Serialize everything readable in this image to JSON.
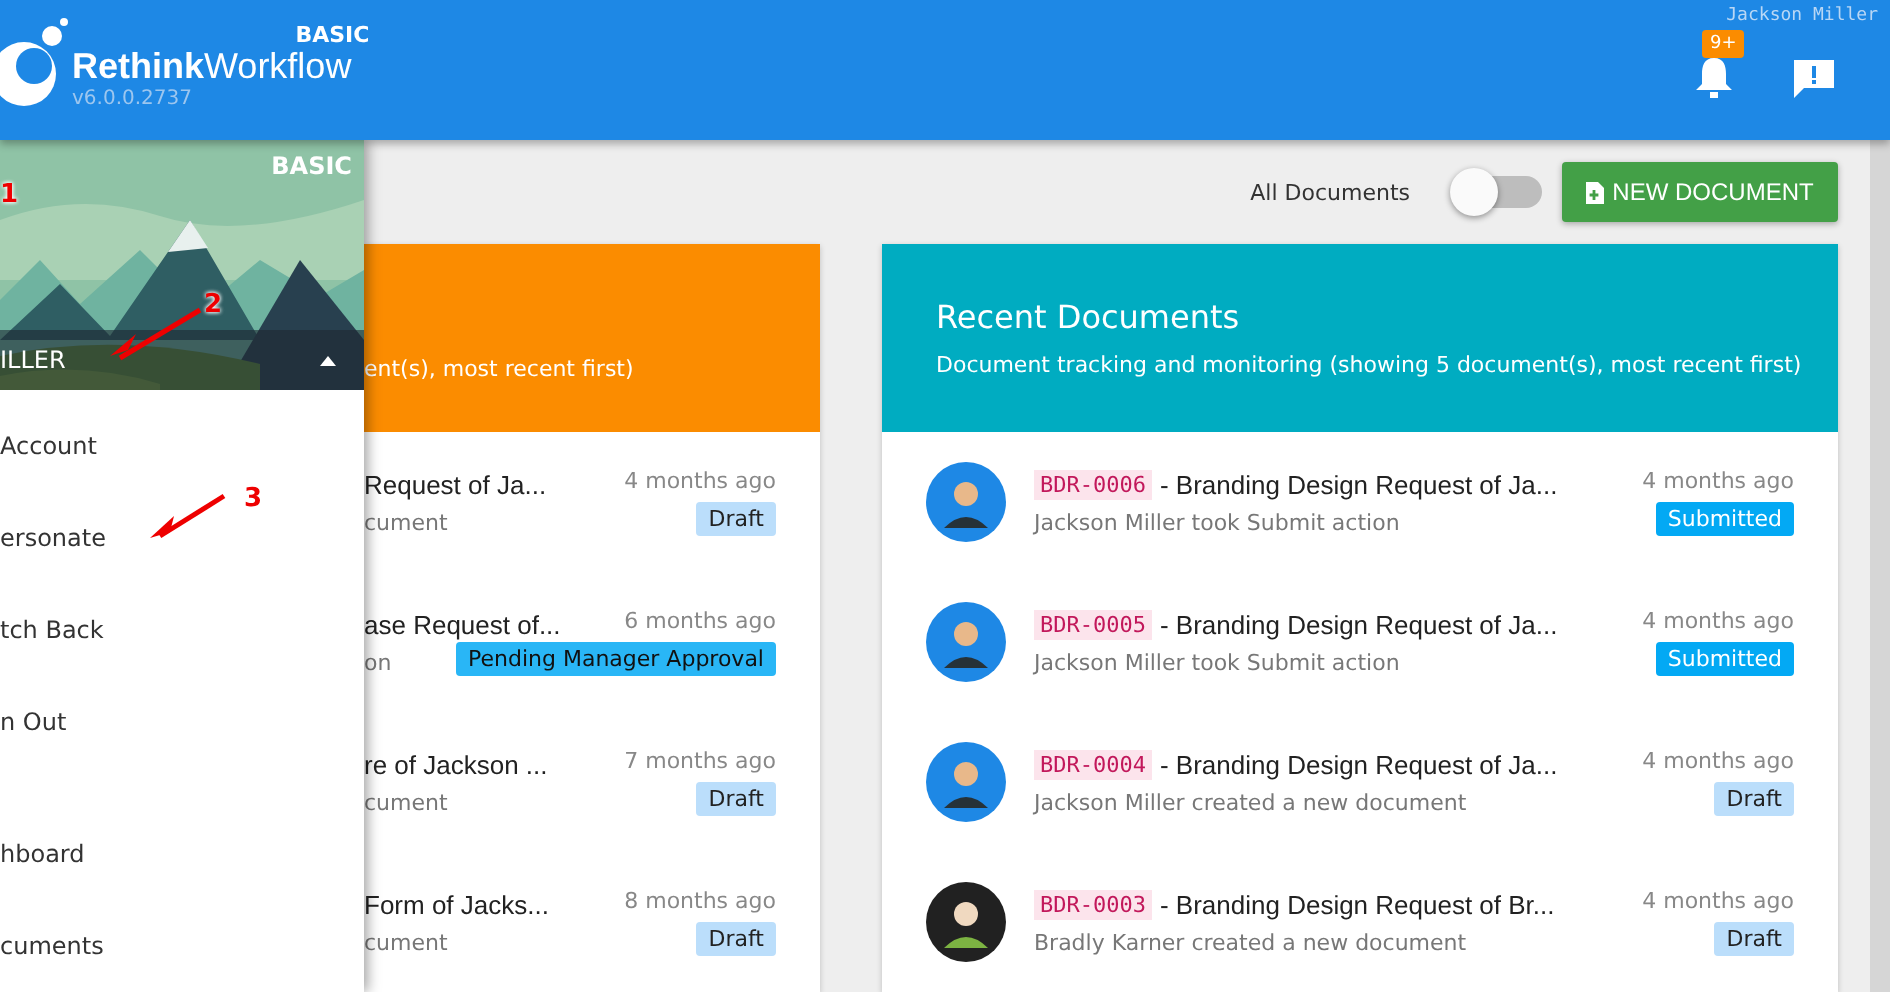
{
  "header": {
    "brand": "**Rethink**Workflow",
    "version": "v6.0.0.2737",
    "edition": "BASIC",
    "user": "Jackson Miller",
    "notifications": "9+"
  },
  "drawer": {
    "edition": "BASIC",
    "user": "ILLER",
    "expanded": true,
    "account_menu": [
      "Account",
      "ersonate",
      "tch Back",
      "n Out"
    ],
    "nav_menu": [
      "hboard",
      "cuments"
    ]
  },
  "annotations": [
    {
      "label": "1"
    },
    {
      "label": "2"
    },
    {
      "label": "3"
    }
  ],
  "toolbar": {
    "filter_label": "All Documents",
    "all_documents_on": false,
    "new_button": "NEW DOCUMENT"
  },
  "cards": [
    {
      "color": "#fb8c00",
      "subtitle": "ent(s), most recent first)",
      "rows": [
        {
          "title": "Request of Ja...",
          "subtitle": "cument",
          "time": "4 months ago",
          "status": {
            "text": "Draft",
            "kind": "draft"
          }
        },
        {
          "title": "ase Request of...",
          "subtitle": "on",
          "time": "6 months ago",
          "status": {
            "text": "Pending Manager Approval",
            "kind": "pending"
          }
        },
        {
          "title": "re of Jackson ...",
          "subtitle": "cument",
          "time": "7 months ago",
          "status": {
            "text": "Draft",
            "kind": "draft"
          }
        },
        {
          "title": "Form of Jacks...",
          "subtitle": "cument",
          "time": "8 months ago",
          "status": {
            "text": "Draft",
            "kind": "draft"
          }
        }
      ]
    },
    {
      "color": "#00acc1",
      "title": "Recent Documents",
      "subtitle": "Document tracking and monitoring (showing 5 document(s), most recent first)",
      "rows": [
        {
          "code": "BDR-0006",
          "title": "- Branding Design Request of Ja...",
          "subtitle": "Jackson Miller took Submit action",
          "time": "4 months ago",
          "status": {
            "text": "Submitted",
            "kind": "submitted"
          },
          "kind": "blue"
        },
        {
          "code": "BDR-0005",
          "title": "- Branding Design Request of Ja...",
          "subtitle": "Jackson Miller took Submit action",
          "time": "4 months ago",
          "status": {
            "text": "Submitted",
            "kind": "submitted"
          },
          "kind": "blue"
        },
        {
          "code": "BDR-0004",
          "title": "- Branding Design Request of Ja...",
          "subtitle": "Jackson Miller created a new document",
          "time": "4 months ago",
          "status": {
            "text": "Draft",
            "kind": "draft"
          },
          "kind": "blue"
        },
        {
          "code": "BDR-0003",
          "title": "- Branding Design Request of Br...",
          "subtitle": "Bradly Karner created a new document",
          "time": "4 months ago",
          "status": {
            "text": "Draft",
            "kind": "draft"
          },
          "kind": "dark"
        }
      ]
    }
  ]
}
